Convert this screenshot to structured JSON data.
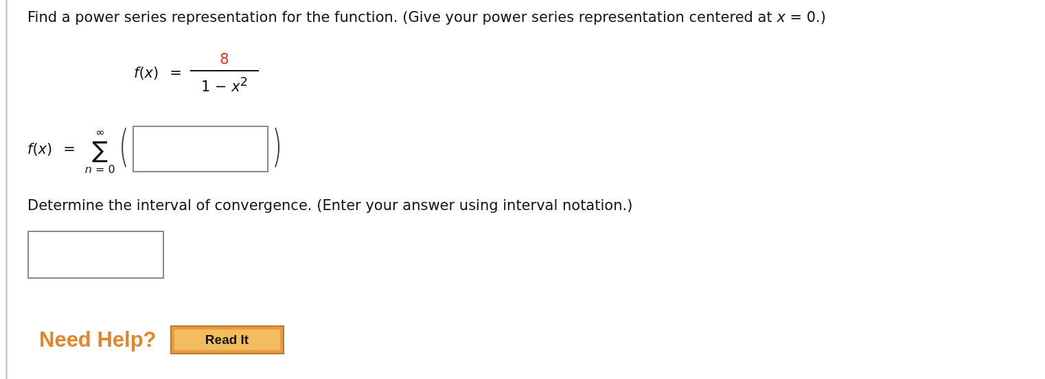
{
  "question": "Find a power series representation for the function. (Give your power series representation centered at *x* = 0.)",
  "function": {
    "lhs": "*f*(*x*)",
    "equals": "=",
    "numerator": "8",
    "denominator": "1 − *x*$^{2}$"
  },
  "series": {
    "lhs": "*f*(*x*)",
    "equals": "=",
    "upper": "∞",
    "sigma": "∑",
    "lower": "*n* = 0",
    "open_paren": "(",
    "close_paren": ")"
  },
  "interval_question": "Determine the interval of convergence. (Enter your answer using interval notation.)",
  "help": {
    "label": "Need Help?",
    "buttons": [
      "Read It"
    ]
  }
}
